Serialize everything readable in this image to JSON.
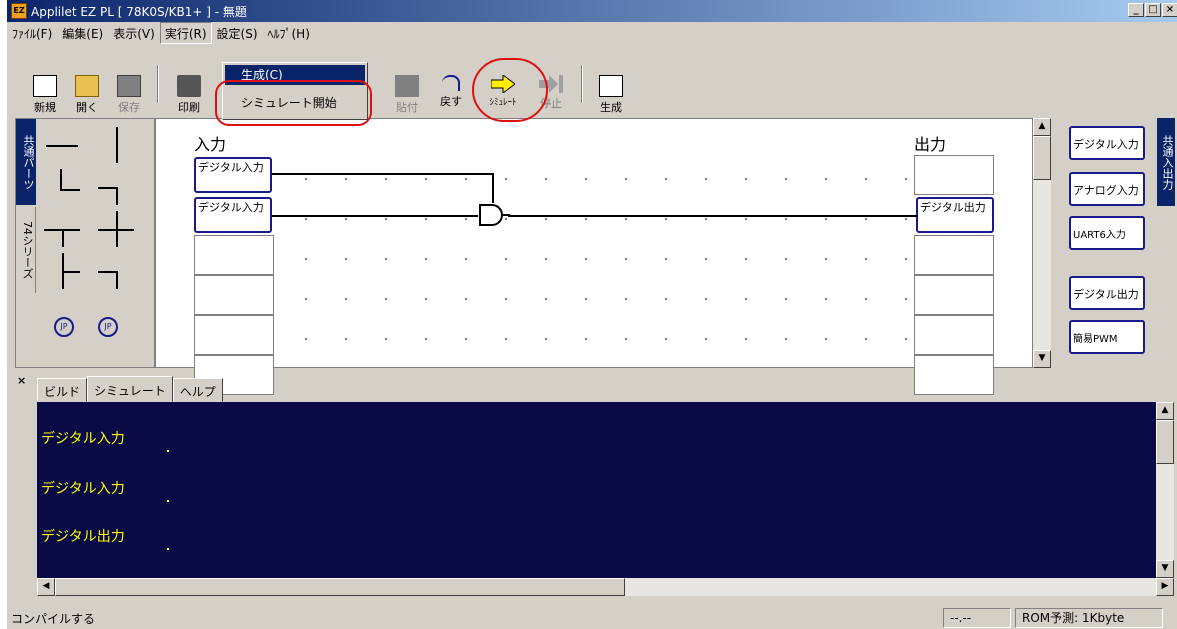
{
  "window": {
    "title": "Applilet EZ PL  [ 78K0S/KB1+ ] - 無題"
  },
  "menu": [
    "ﾌｧｲﾙ(F)",
    "編集(E)",
    "表示(V)",
    "実行(R)",
    "設定(S)",
    "ﾍﾙﾌﾟ(H)"
  ],
  "toolbar": {
    "new": "新規",
    "open": "開く",
    "save": "保存",
    "print": "印刷",
    "paste": "貼付",
    "undo": "戻す",
    "simulate": "ｼﾐｭﾚｰﾄ",
    "stop": "停止",
    "generate": "生成"
  },
  "dropdown": {
    "item1": "生成(C)",
    "item2": "シミュレート開始"
  },
  "palette": {
    "tab_common": "共通パーツ",
    "tab_74": "74シリーズ",
    "jp_label": "JP"
  },
  "canvas": {
    "input_header": "入力",
    "output_header": "出力",
    "in1": "デジタル入力",
    "in2": "デジタル入力",
    "out1": "デジタル出力"
  },
  "right_palette": {
    "tab": "共通入出力",
    "items": [
      "デジタル入力",
      "アナログ入力",
      "UART6入力",
      "デジタル出力",
      "簡易PWM"
    ]
  },
  "output": {
    "tabs": [
      "ビルド",
      "シミュレート",
      "ヘルプ"
    ],
    "lines": [
      "デジタル入力",
      "デジタル入力",
      "デジタル出力"
    ]
  },
  "status": {
    "left": "コンパイルする",
    "pos": "--.--",
    "rom": "ROM予測:  1Kbyte"
  }
}
